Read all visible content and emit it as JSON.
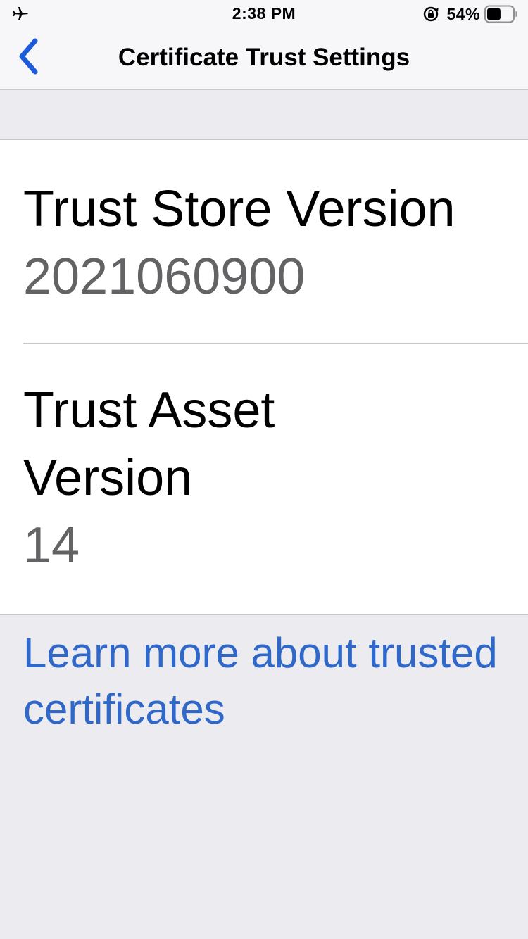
{
  "status_bar": {
    "left_icon": "airplane-icon",
    "time": "2:38 PM",
    "rotation_lock_icon": "rotation-lock-icon",
    "battery_percent": "54%",
    "battery_level": 0.54,
    "battery_icon": "battery-icon"
  },
  "nav": {
    "back_icon": "chevron-left-icon",
    "title": "Certificate Trust Settings",
    "accent_color": "#1c5bd9"
  },
  "rows": [
    {
      "label": "Trust Store Version",
      "value": "2021060900"
    },
    {
      "label": "Trust Asset Version",
      "value": "14"
    }
  ],
  "footer": {
    "link_text": "Learn more about trusted certificates",
    "link_color": "#2f68c9"
  }
}
